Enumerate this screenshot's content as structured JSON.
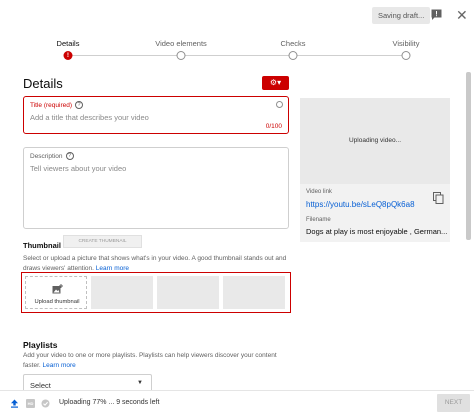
{
  "topbar": {
    "saving_label": "Saving draft...",
    "feedback_icon": "feedback-icon",
    "close_icon": "close-icon"
  },
  "steps": [
    {
      "label": "Details",
      "active": true,
      "marker": "!"
    },
    {
      "label": "Video elements",
      "active": false
    },
    {
      "label": "Checks",
      "active": false
    },
    {
      "label": "Visibility",
      "active": false
    }
  ],
  "details": {
    "heading": "Details",
    "studio_icon": "studio-menu-icon",
    "title_field": {
      "label": "Title (required)",
      "placeholder": "Add a title that describes your video",
      "counter": "0/100"
    },
    "description_field": {
      "label": "Description",
      "placeholder": "Tell viewers about your video"
    }
  },
  "preview": {
    "status": "Uploading video...",
    "video_link_label": "Video link",
    "video_link": "https://youtu.be/sLeQ8pQk6a8",
    "filename_label": "Filename",
    "filename": "Dogs at play is most enjoyable , German..."
  },
  "thumbnail": {
    "heading": "Thumbnail",
    "create_button": "CREATE THUMBNAIL",
    "description": "Select or upload a picture that shows what's in your video. A good thumbnail stands out and draws viewers' attention.",
    "learn_more": "Learn more",
    "upload_label": "Upload thumbnail"
  },
  "playlists": {
    "heading": "Playlists",
    "description": "Add your video to one or more playlists. Playlists can help viewers discover your content faster.",
    "learn_more": "Learn more",
    "select_value": "Select"
  },
  "footer": {
    "status": "Uploading 77% ... 9 seconds left",
    "hd_badge": "HD",
    "next_label": "NEXT"
  },
  "colors": {
    "accent": "#cc0000",
    "link": "#065fd4"
  }
}
